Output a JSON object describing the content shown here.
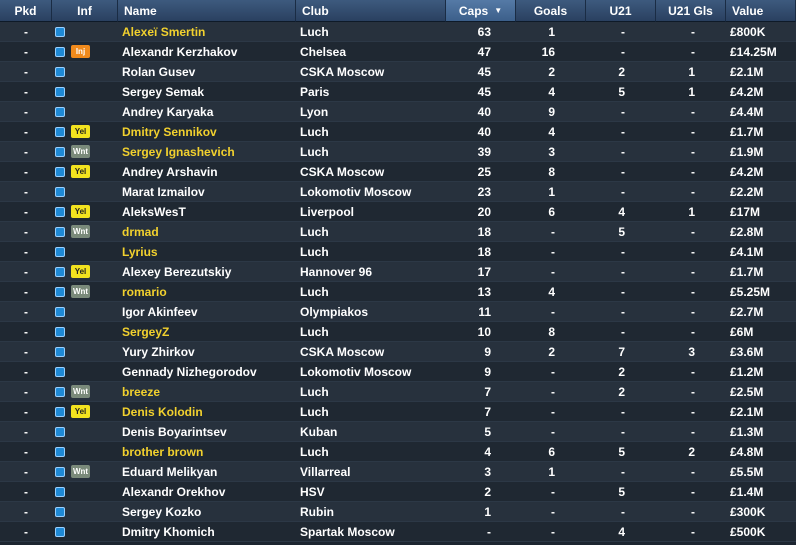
{
  "headers": {
    "pkd": "Pkd",
    "inf": "Inf",
    "name": "Name",
    "club": "Club",
    "caps": "Caps",
    "goals": "Goals",
    "u21": "U21",
    "u21gls": "U21 Gls",
    "value": "Value"
  },
  "sorted_by": "caps",
  "sort_direction": "descending",
  "rows": [
    {
      "pkd": "-",
      "status": "",
      "name": "Alexeï Smertin",
      "club": "Luch",
      "caps": "63",
      "goals": "1",
      "u21": "-",
      "u21gls": "-",
      "value": "£800K",
      "human": true
    },
    {
      "pkd": "-",
      "status": "Inj",
      "name": "Alexandr Kerzhakov",
      "club": "Chelsea",
      "caps": "47",
      "goals": "16",
      "u21": "-",
      "u21gls": "-",
      "value": "£14.25M",
      "human": false
    },
    {
      "pkd": "-",
      "status": "",
      "name": "Rolan Gusev",
      "club": "CSKA Moscow",
      "caps": "45",
      "goals": "2",
      "u21": "2",
      "u21gls": "1",
      "value": "£2.1M",
      "human": false
    },
    {
      "pkd": "-",
      "status": "",
      "name": "Sergey Semak",
      "club": "Paris",
      "caps": "45",
      "goals": "4",
      "u21": "5",
      "u21gls": "1",
      "value": "£4.2M",
      "human": false
    },
    {
      "pkd": "-",
      "status": "",
      "name": "Andrey Karyaka",
      "club": "Lyon",
      "caps": "40",
      "goals": "9",
      "u21": "-",
      "u21gls": "-",
      "value": "£4.4M",
      "human": false
    },
    {
      "pkd": "-",
      "status": "Yel",
      "name": "Dmitry Sennikov",
      "club": "Luch",
      "caps": "40",
      "goals": "4",
      "u21": "-",
      "u21gls": "-",
      "value": "£1.7M",
      "human": true
    },
    {
      "pkd": "-",
      "status": "Wnt",
      "name": "Sergey Ignashevich",
      "club": "Luch",
      "caps": "39",
      "goals": "3",
      "u21": "-",
      "u21gls": "-",
      "value": "£1.9M",
      "human": true
    },
    {
      "pkd": "-",
      "status": "Yel",
      "name": "Andrey Arshavin",
      "club": "CSKA Moscow",
      "caps": "25",
      "goals": "8",
      "u21": "-",
      "u21gls": "-",
      "value": "£4.2M",
      "human": false
    },
    {
      "pkd": "-",
      "status": "",
      "name": "Marat Izmailov",
      "club": "Lokomotiv Moscow",
      "caps": "23",
      "goals": "1",
      "u21": "-",
      "u21gls": "-",
      "value": "£2.2M",
      "human": false
    },
    {
      "pkd": "-",
      "status": "Yel",
      "name": "AleksWesT",
      "club": "Liverpool",
      "caps": "20",
      "goals": "6",
      "u21": "4",
      "u21gls": "1",
      "value": "£17M",
      "human": false
    },
    {
      "pkd": "-",
      "status": "Wnt",
      "name": "drmad",
      "club": "Luch",
      "caps": "18",
      "goals": "-",
      "u21": "5",
      "u21gls": "-",
      "value": "£2.8M",
      "human": true
    },
    {
      "pkd": "-",
      "status": "",
      "name": "Lyrius",
      "club": "Luch",
      "caps": "18",
      "goals": "-",
      "u21": "-",
      "u21gls": "-",
      "value": "£4.1M",
      "human": true
    },
    {
      "pkd": "-",
      "status": "Yel",
      "name": "Alexey Berezutskiy",
      "club": "Hannover 96",
      "caps": "17",
      "goals": "-",
      "u21": "-",
      "u21gls": "-",
      "value": "£1.7M",
      "human": false
    },
    {
      "pkd": "-",
      "status": "Wnt",
      "name": "romario",
      "club": "Luch",
      "caps": "13",
      "goals": "4",
      "u21": "-",
      "u21gls": "-",
      "value": "£5.25M",
      "human": true
    },
    {
      "pkd": "-",
      "status": "",
      "name": "Igor Akinfeev",
      "club": "Olympiakos",
      "caps": "11",
      "goals": "-",
      "u21": "-",
      "u21gls": "-",
      "value": "£2.7M",
      "human": false
    },
    {
      "pkd": "-",
      "status": "",
      "name": "SergeyZ",
      "club": "Luch",
      "caps": "10",
      "goals": "8",
      "u21": "-",
      "u21gls": "-",
      "value": "£6M",
      "human": true
    },
    {
      "pkd": "-",
      "status": "",
      "name": "Yury Zhirkov",
      "club": "CSKA Moscow",
      "caps": "9",
      "goals": "2",
      "u21": "7",
      "u21gls": "3",
      "value": "£3.6M",
      "human": false
    },
    {
      "pkd": "-",
      "status": "",
      "name": "Gennady Nizhegorodov",
      "club": "Lokomotiv Moscow",
      "caps": "9",
      "goals": "-",
      "u21": "2",
      "u21gls": "-",
      "value": "£1.2M",
      "human": false
    },
    {
      "pkd": "-",
      "status": "Wnt",
      "name": "breeze",
      "club": "Luch",
      "caps": "7",
      "goals": "-",
      "u21": "2",
      "u21gls": "-",
      "value": "£2.5M",
      "human": true
    },
    {
      "pkd": "-",
      "status": "Yel",
      "name": "Denis Kolodin",
      "club": "Luch",
      "caps": "7",
      "goals": "-",
      "u21": "-",
      "u21gls": "-",
      "value": "£2.1M",
      "human": true
    },
    {
      "pkd": "-",
      "status": "",
      "name": "Denis Boyarintsev",
      "club": "Kuban",
      "caps": "5",
      "goals": "-",
      "u21": "-",
      "u21gls": "-",
      "value": "£1.3M",
      "human": false
    },
    {
      "pkd": "-",
      "status": "",
      "name": "brother brown",
      "club": "Luch",
      "caps": "4",
      "goals": "6",
      "u21": "5",
      "u21gls": "2",
      "value": "£4.8M",
      "human": true
    },
    {
      "pkd": "-",
      "status": "Wnt",
      "name": "Eduard Melikyan",
      "club": "Villarreal",
      "caps": "3",
      "goals": "1",
      "u21": "-",
      "u21gls": "-",
      "value": "£5.5M",
      "human": false
    },
    {
      "pkd": "-",
      "status": "",
      "name": "Alexandr Orekhov",
      "club": "HSV",
      "caps": "2",
      "goals": "-",
      "u21": "5",
      "u21gls": "-",
      "value": "£1.4M",
      "human": false
    },
    {
      "pkd": "-",
      "status": "",
      "name": "Sergey Kozko",
      "club": "Rubin",
      "caps": "1",
      "goals": "-",
      "u21": "-",
      "u21gls": "-",
      "value": "£300K",
      "human": false
    },
    {
      "pkd": "-",
      "status": "",
      "name": "Dmitry Khomich",
      "club": "Spartak Moscow",
      "caps": "-",
      "goals": "-",
      "u21": "4",
      "u21gls": "-",
      "value": "£500K",
      "human": false
    }
  ]
}
